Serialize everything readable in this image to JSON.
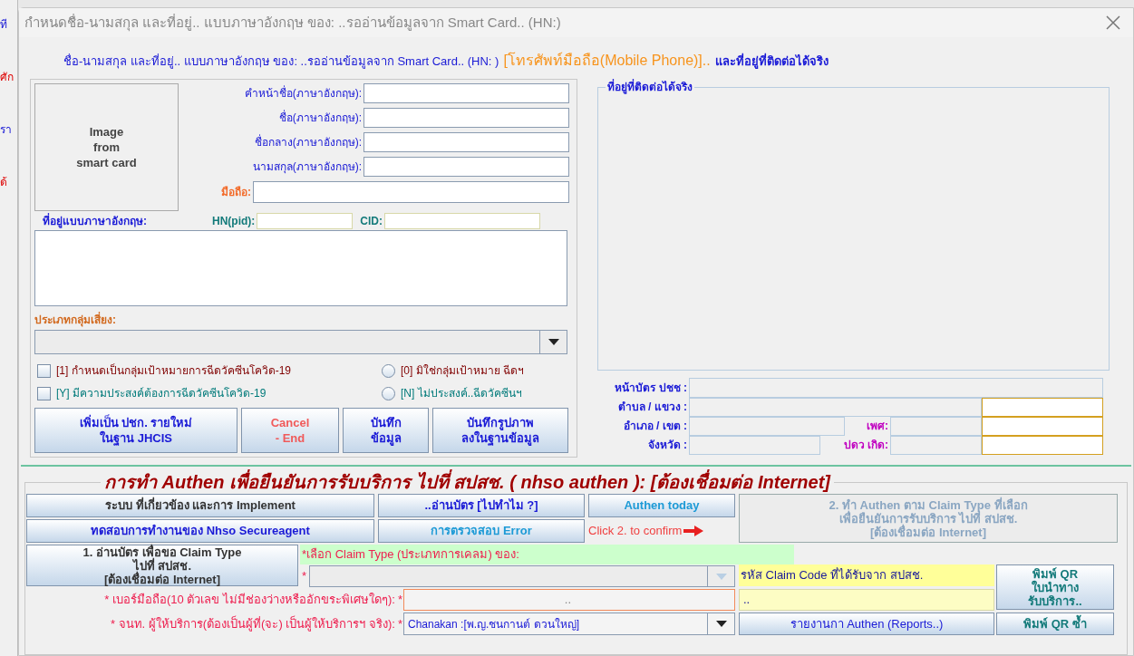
{
  "background_window": {
    "fragments": [
      "ที",
      "ศัก",
      "รา",
      "ด้"
    ]
  },
  "window": {
    "title": "กำหนดชื่อ-นามสกุล และที่อยู่.. แบบภาษาอังกฤษ ของ: ..รออ่านข้อมูลจาก Smart Card.. (HN:)"
  },
  "heading": {
    "main": "ชื่อ-นามสกุล และที่อยู่.. แบบภาษาอังกฤษ ของ: ..รออ่านข้อมูลจาก Smart Card.. (HN: )",
    "phone": "[โทรศัพท์มือถือ(Mobile Phone)]..",
    "tail": "และที่อยู่ที่ติดต่อได้จริง"
  },
  "photo": {
    "lines": [
      "Image",
      "from",
      "smart card"
    ]
  },
  "name_fields": [
    {
      "label": "คำหน้าชื่อ(ภาษาอังกฤษ):"
    },
    {
      "label": "ชื่อ(ภาษาอังกฤษ):"
    },
    {
      "label": "ชื่อกลาง(ภาษาอังกฤษ):"
    },
    {
      "label": "นามสกุล(ภาษาอังกฤษ):"
    }
  ],
  "mobile": {
    "label": "มือถือ:"
  },
  "address": {
    "label": "ที่อยู่แบบภาษาอังกฤษ:",
    "hn_label": "HN(pid):",
    "cid_label": "CID:"
  },
  "risk_group": {
    "label": "ประเภทกลุ่มเสี่ยง:"
  },
  "options": [
    {
      "kind": "checkbox",
      "label": "[1] กำหนดเป็นกลุ่มเป้าหมายการฉีดวัคซีนโควิด-19",
      "checked": false,
      "color": "#800000"
    },
    {
      "kind": "radio",
      "label": "[0] มิใช่กลุ่มเป้าหมาย ฉีดฯ",
      "selected": false,
      "color": "#800000"
    },
    {
      "kind": "checkbox",
      "label": "[Y] มีความประสงค์ต้องการฉีดวัคซีนโควิด-19",
      "checked": false,
      "color": "#007a7a"
    },
    {
      "kind": "radio",
      "label": "[N] ไม่ประสงค์..ฉีดวัคซีนฯ",
      "selected": false,
      "color": "#007a7a"
    }
  ],
  "actions": [
    {
      "kind": "normal",
      "lines": [
        "เพิ่มเป็น ปชก. รายใหม่",
        "ในฐาน JHCIS"
      ]
    },
    {
      "kind": "danger",
      "lines": [
        "Cancel",
        "- End"
      ]
    },
    {
      "kind": "normal",
      "lines": [
        "บันทึก",
        "ข้อมูล"
      ]
    },
    {
      "kind": "normal",
      "lines": [
        "บันทึกรูปภาพ",
        "ลงในฐานข้อมูล"
      ]
    }
  ],
  "contact": {
    "legend": "ที่อยู่ที่ติดต่อได้จริง",
    "id_card": "หน้าบัตร ปชช :",
    "subdistrict": "ตำบล / แขวง :",
    "district": "อำเภอ / เขต :",
    "province": "จังหวัด :",
    "sex": "เพศ:",
    "birth_year": "ปดว เกิด:"
  },
  "authen": {
    "title": "การทำ Authen เพื่อยืนยันการรับบริการ ไปที่ สปสช. ( nhso authen ): [ต้องเชื่อมต่อ Internet]",
    "top_buttons": [
      {
        "kind": "gray",
        "label": "ระบบ ที่เกี่ยวข้อง และการ Implement"
      },
      {
        "kind": "blue",
        "label": "..อ่านบัตร [ไปทำไม ?]"
      },
      {
        "kind": "sky",
        "label": "Authen today"
      },
      {
        "kind": "blue",
        "label": "ทดสอบการทำงานของ Nhso Secureagent"
      },
      {
        "kind": "sky",
        "label": "การตรวจสอบ Error"
      }
    ],
    "hint": "Click 2. to confirm",
    "confirm_button": {
      "lines": [
        "2. ทำ Authen ตาม Claim Type ที่เลือก",
        "เพื่อยืนยันการรับบริการ ไปที่ สปสช.",
        "[ต้องเชื่อมต่อ Internet]"
      ],
      "disabled": true
    },
    "read_button": {
      "lines": [
        "1. อ่านบัตร เพื่อขอ Claim Type",
        "ไปที่ สปสช.",
        "[ต้องเชื่อมต่อ Internet]"
      ]
    },
    "claim_type_label": "*เลือก Claim Type (ประเภทการเคลม) ของ:",
    "required_mark": "*",
    "claim_type_combo": {
      "disabled": true
    },
    "claim_code_label": "รหัส Claim Code ที่ได้รับจาก สปสช.",
    "claim_code_value": "..",
    "phone_label": "* เบอร์มือถือ(10 ตัวเลข ไม่มีช่องว่างหรืออักขระพิเศษใดๆ):",
    "phone_mark": "*",
    "phone_value": "..",
    "provider_label": "* จนท. ผู้ให้บริการ(ต้องเป็นผู้ที่(จะ) เป็นผู้ให้บริการฯ จริง):",
    "provider_mark": "*",
    "provider_value": "Chanakan :[พ.ญ.ชนกานต์ ดวนใหญ่]",
    "print_qr": {
      "lines": [
        "พิมพ์ QR",
        "ใบนำทาง",
        "รับบริการ.."
      ]
    },
    "reports": "รายงานกา Authen (Reports..)",
    "reprint": "พิมพ์ QR ซ้ำ"
  }
}
